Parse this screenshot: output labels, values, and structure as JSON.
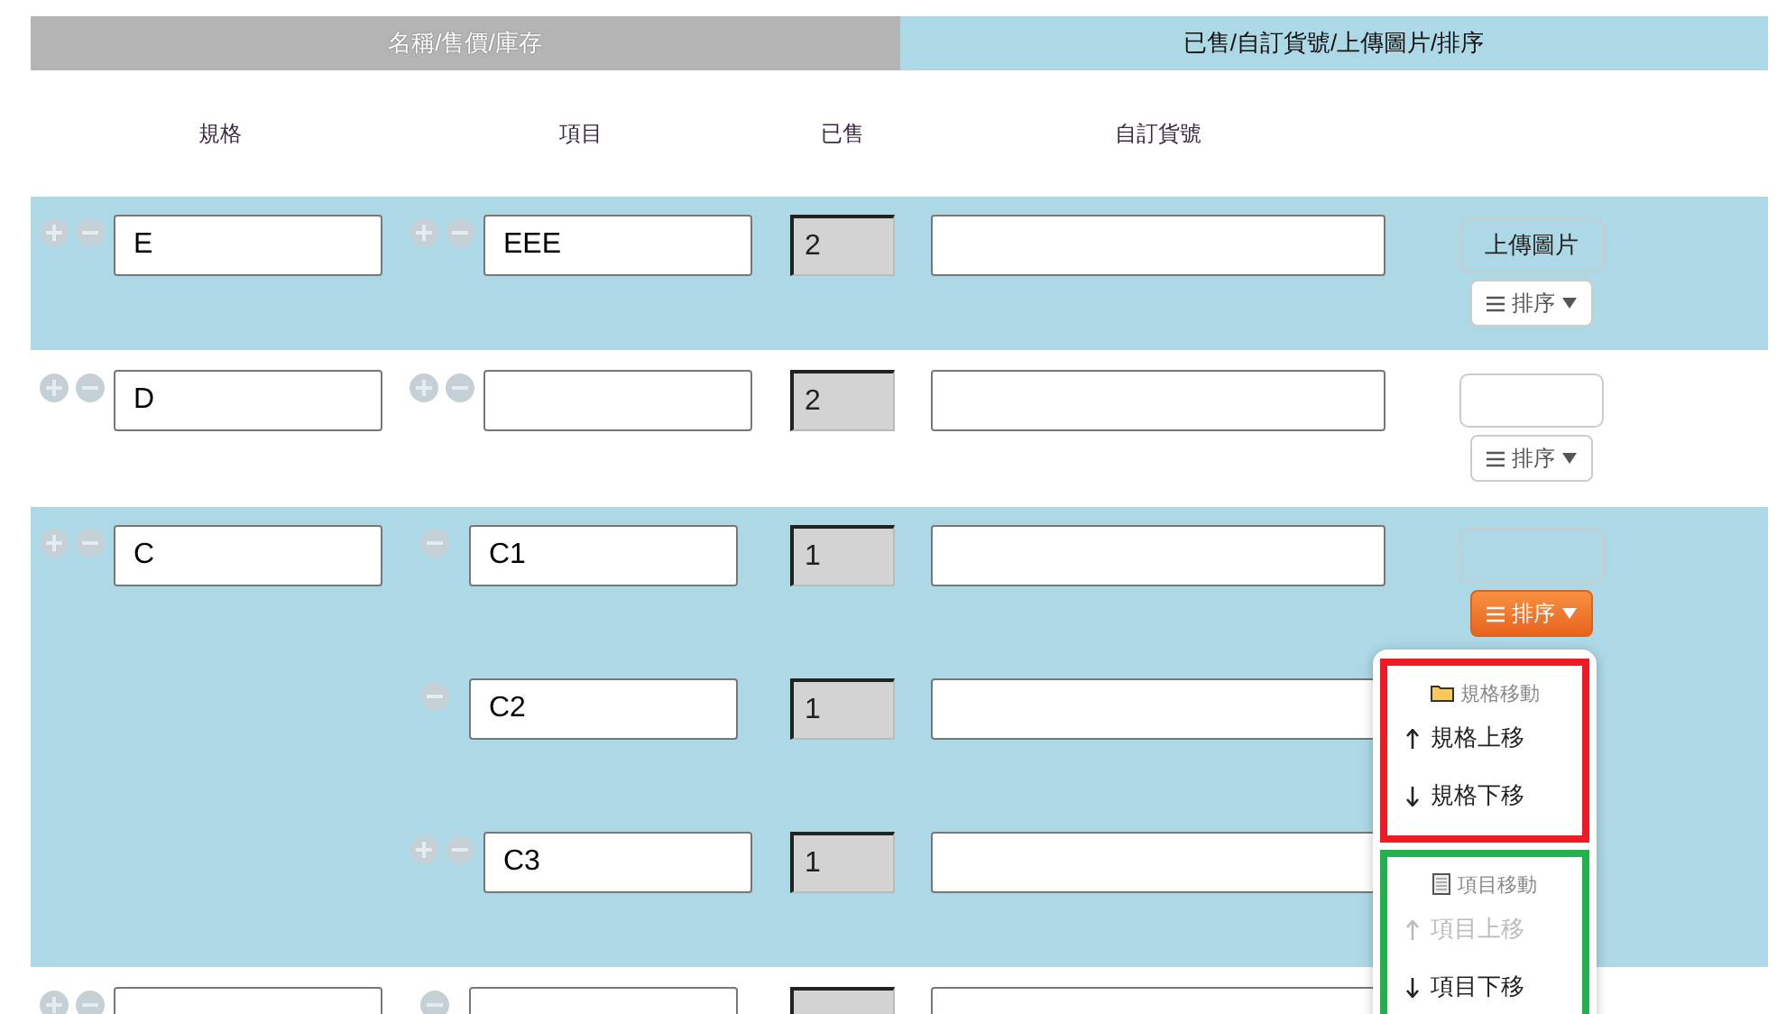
{
  "tabs": [
    {
      "label": "名稱/售價/庫存",
      "selected": false
    },
    {
      "label": "已售/自訂貨號/上傳圖片/排序",
      "selected": true
    }
  ],
  "columns": [
    "規格",
    "項目",
    "已售",
    "自訂貨號"
  ],
  "specs": [
    {
      "name": "E",
      "highlighted": true,
      "upload_label": "上傳圖片",
      "sort": {
        "label": "排序",
        "open": false
      },
      "items": [
        {
          "name": "EEE",
          "can_add": true,
          "sold": "2"
        }
      ]
    },
    {
      "name": "D",
      "highlighted": false,
      "sort": {
        "label": "排序",
        "open": false
      },
      "items": [
        {
          "can_add": true,
          "sold": "2"
        }
      ]
    },
    {
      "name": "C",
      "highlighted": true,
      "sort": {
        "label": "排序",
        "open": true
      },
      "items": [
        {
          "name": "C1",
          "can_add": false,
          "sold": "1"
        },
        {
          "name": "C2",
          "can_add": false,
          "sold": "1"
        },
        {
          "name": "C3",
          "can_add": true,
          "sold": "1"
        }
      ]
    },
    {
      "highlighted": false,
      "items": [
        {
          "can_add": false
        }
      ]
    }
  ],
  "menu": {
    "groups": [
      {
        "title": "規格移動",
        "kind": "folder",
        "color": "#ed1c24",
        "items": [
          {
            "label": "規格上移",
            "kind": "up",
            "disabled": false
          },
          {
            "label": "規格下移",
            "kind": "down",
            "disabled": false
          }
        ]
      },
      {
        "title": "項目移動",
        "kind": "document",
        "color": "#22b14c",
        "items": [
          {
            "label": "項目上移",
            "kind": "up",
            "disabled": true
          },
          {
            "label": "項目下移",
            "kind": "down",
            "disabled": false
          }
        ]
      }
    ]
  }
}
